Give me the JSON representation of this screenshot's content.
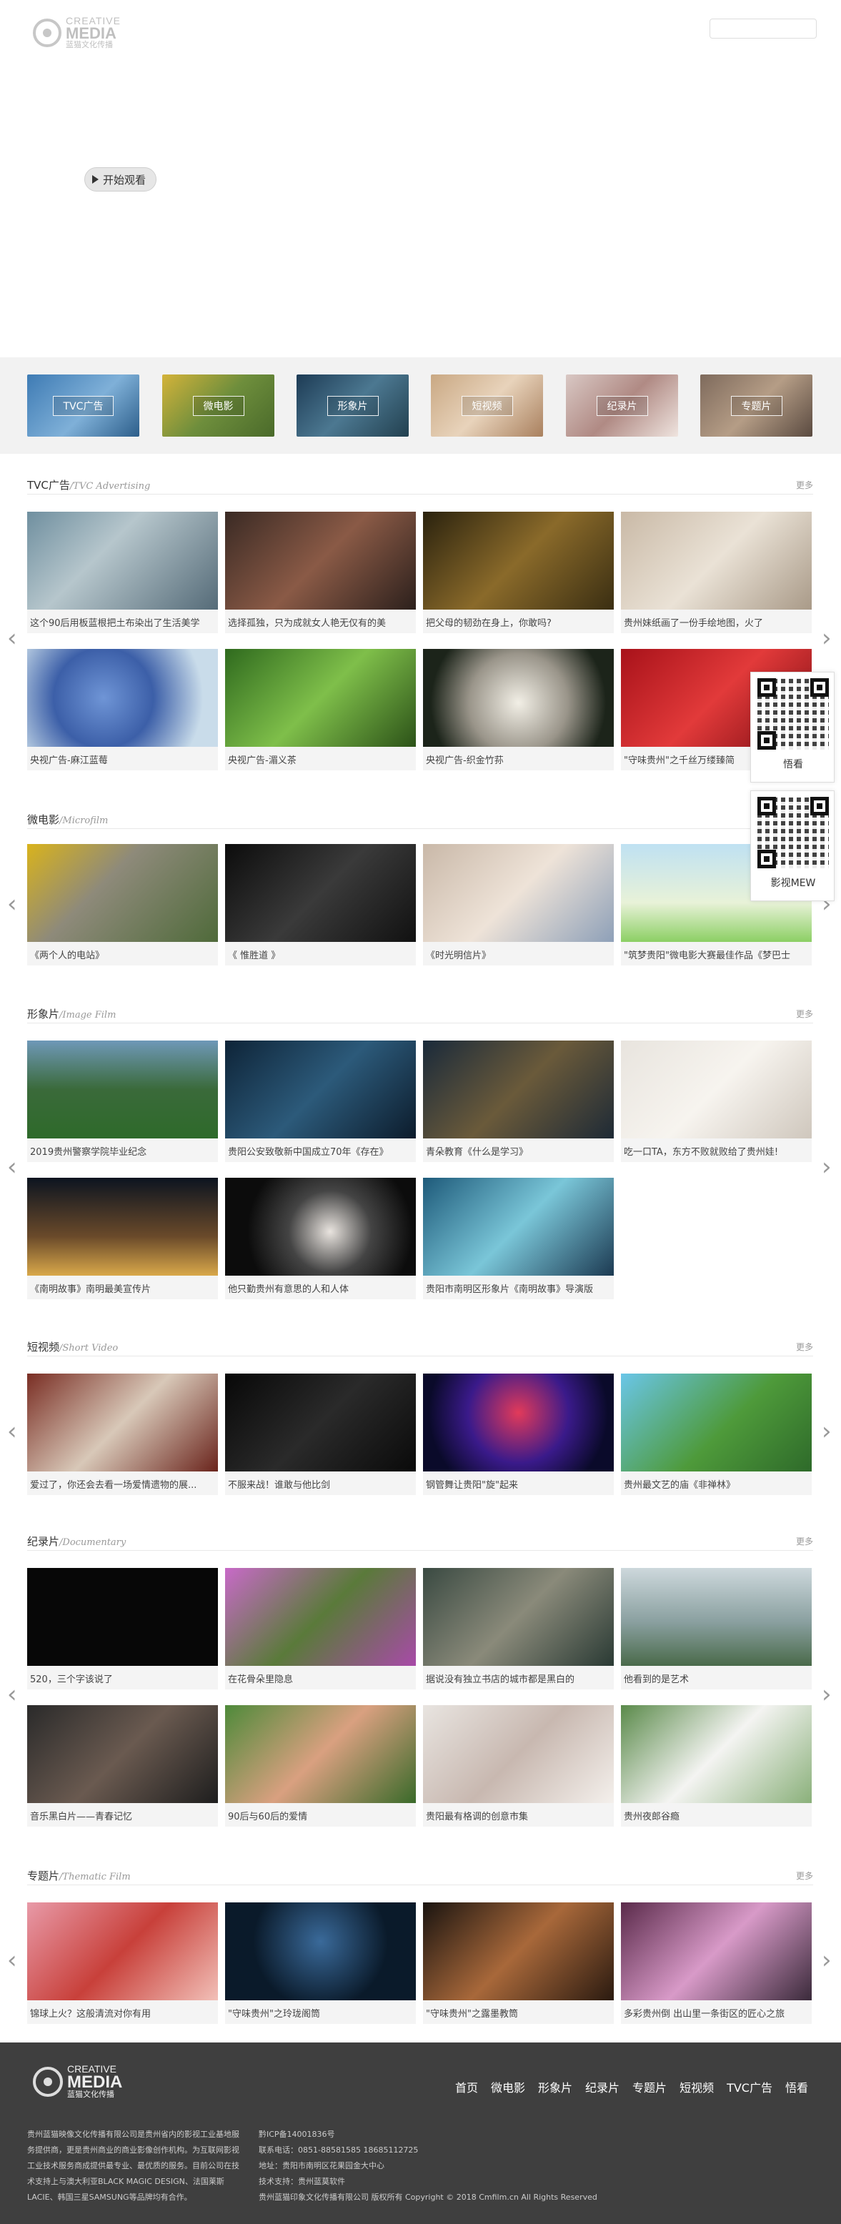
{
  "header": {
    "logo_line1": "CREATIVE",
    "logo_line2": "MEDIA",
    "logo_line3": "蓝猫文化传播",
    "search_placeholder": "",
    "play_label": "开始观看"
  },
  "categories": [
    {
      "label": "TVC广告"
    },
    {
      "label": "微电影"
    },
    {
      "label": "形象片"
    },
    {
      "label": "短视频"
    },
    {
      "label": "纪录片"
    },
    {
      "label": "专题片"
    }
  ],
  "sections": [
    {
      "title": "TVC广告",
      "en": "/TVC Advertising",
      "more": "更多",
      "items": [
        "这个90后用板蓝根把土布染出了生活美学",
        "选择孤独，只为成就女人艳无仅有的美",
        "把父母的韧劲在身上，你敢吗?",
        "贵州妹纸画了一份手绘地图，火了",
        "央视广告-麻江蓝莓",
        "央视广告-湄义茶",
        "央视广告-织金竹荪",
        "\"守味贵州\"之千丝万缕臻简"
      ]
    },
    {
      "title": "微电影",
      "en": "/Microfilm",
      "more": "",
      "items": [
        "《两个人的电站》",
        "《 惟胜道 》",
        "《时光明信片》",
        "\"筑梦贵阳\"微电影大赛最佳作品《梦巴士"
      ]
    },
    {
      "title": "形象片",
      "en": "/Image Film",
      "more": "更多",
      "items": [
        "2019贵州警察学院毕业纪念",
        "贵阳公安致敬新中国成立70年《存在》",
        "青朵教育《什么是学习》",
        "吃一口TA，东方不败就败给了贵州娃!",
        "《南明故事》南明最美宣传片",
        "他只勤贵州有意思的人和人体",
        "贵阳市南明区形象片《南明故事》导演版"
      ]
    },
    {
      "title": "短视频",
      "en": "/Short Video",
      "more": "更多",
      "items": [
        "爱过了，你还会去看一场爱情遗物的展...",
        "不服来战！谁敢与他比剑",
        "钢管舞让贵阳\"旋\"起来",
        "贵州最文艺的庙《非禅林》"
      ]
    },
    {
      "title": "纪录片",
      "en": "/Documentary",
      "more": "更多",
      "items": [
        "520，三个字该说了",
        "在花骨朵里隐息",
        "据说没有独立书店的城市都是黑白的",
        "他看到的是艺术",
        "音乐黑白片——青春记忆",
        "90后与60后的爱情",
        "贵阳最有格调的创意市集",
        "贵州夜郎谷瘾"
      ]
    },
    {
      "title": "专题片",
      "en": "/Thematic Film",
      "more": "更多",
      "items": [
        "锦球上火？这般清流对你有用",
        "\"守味贵州\"之玲珑阁筒",
        "\"守味贵州\"之露墨教筒",
        "多彩贵州倒 出山里一条街区的匠心之旅"
      ]
    }
  ],
  "qr": [
    {
      "label": "悟看"
    },
    {
      "label": "影视MEW"
    }
  ],
  "footer": {
    "logo_line1": "CREATIVE",
    "logo_line2": "MEDIA",
    "logo_line3": "蓝猫文化传播",
    "nav": [
      "首页",
      "微电影",
      "形象片",
      "纪录片",
      "专题片",
      "短视频",
      "TVC广告",
      "悟看"
    ],
    "about": "贵州蓝猫映像文化传播有限公司是贵州省内的影视工业基地服务提供商，更是贵州商业的商业影像创作机构。为互联网影视工业技术服务商成提供最专业、最优质的服务。目前公司在技术支持上与澳大利亚BLACK MAGIC DESIGN、法国莱斯LACIE、韩国三星SAMSUNG等品牌均有合作。",
    "icp": "黔ICP备14001836号",
    "phone": "联系电话：0851-88581585 18685112725",
    "address": "地址：贵阳市南明区花果园金大中心",
    "support": "技术支持：贵州蓝莫软件",
    "copyright": "贵州蓝猫印象文化传播有限公司 版权所有 Copyright © 2018 Cmfilm.cn All Rights Reserved"
  }
}
